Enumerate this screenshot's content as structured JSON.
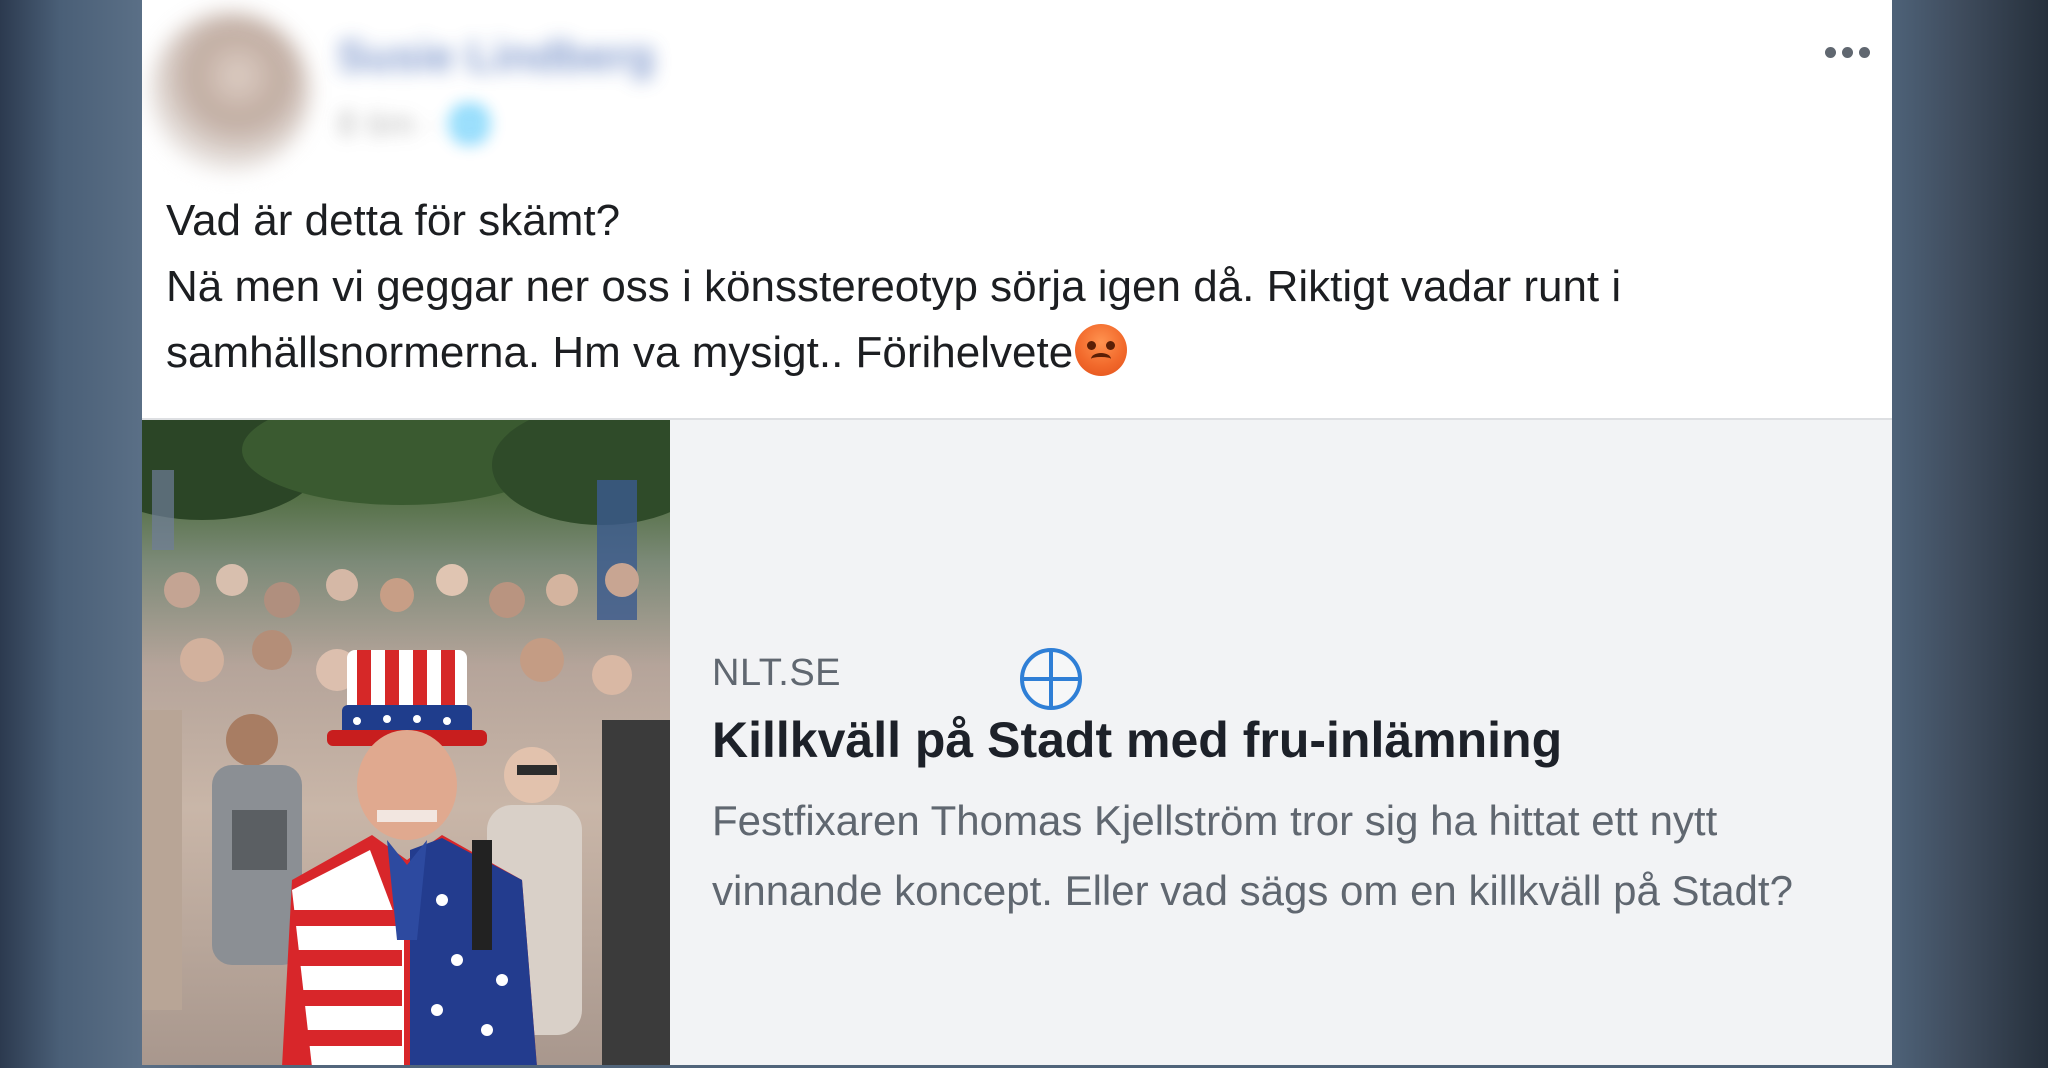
{
  "post": {
    "author": {
      "name": "Susie Lindberg",
      "meta": "8 tim · 🌐"
    },
    "menu_icon": "more-horizontal-icon",
    "text": {
      "line1": "Vad är detta för skämt?",
      "line2": "Nä men vi geggar ner oss i könsstereotyp sörja igen då. Riktigt vadar runt i samhällsnormerna. Hm va mysigt.. Förihelvete"
    },
    "emoji": "angry-face-emoji"
  },
  "link": {
    "domain": "NLT.SE",
    "title": "Killkväll på Stadt med fru-inlämning",
    "description": "Festfixaren Thomas Kjellström tror sig ha hittat ett nytt vinnande koncept. Eller vad sägs om en killkväll på Stadt?",
    "image": "crowd-man-in-american-flag-outfit-photo"
  },
  "colors": {
    "post_text": "#1c1e21",
    "card_bg": "#f2f3f5",
    "domain_text": "#606770",
    "title_text": "#1d2129",
    "cursor": "#2f7fd6"
  }
}
